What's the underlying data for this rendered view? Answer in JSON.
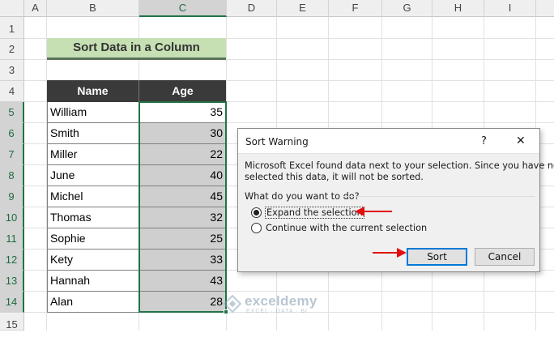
{
  "columns": [
    "A",
    "B",
    "C",
    "D",
    "E",
    "F",
    "G",
    "H",
    "I"
  ],
  "rows": [
    "1",
    "2",
    "3",
    "4",
    "5",
    "6",
    "7",
    "8",
    "9",
    "10",
    "11",
    "12",
    "13",
    "14",
    "15"
  ],
  "sheet_title": "Sort Data in a Column",
  "table": {
    "headers": [
      "Name",
      "Age"
    ],
    "rows": [
      {
        "name": "William",
        "age": "35"
      },
      {
        "name": "Smith",
        "age": "30"
      },
      {
        "name": "Miller",
        "age": "22"
      },
      {
        "name": "June",
        "age": "40"
      },
      {
        "name": "Michel",
        "age": "45"
      },
      {
        "name": "Thomas",
        "age": "32"
      },
      {
        "name": "Sophie",
        "age": "25"
      },
      {
        "name": "Kety",
        "age": "33"
      },
      {
        "name": "Hannah",
        "age": "43"
      },
      {
        "name": "Alan",
        "age": "28"
      }
    ]
  },
  "dialog": {
    "title": "Sort Warning",
    "help_icon": "?",
    "close_icon": "✕",
    "message_line1": "Microsoft Excel found data next to your selection.  Since you have not",
    "message_line2": "selected this data, it will not be sorted.",
    "question": "What do you want to do?",
    "option_expand": "Expand the selection",
    "option_continue": "Continue with the current selection",
    "selected_option": "expand",
    "sort_button": "Sort",
    "cancel_button": "Cancel"
  },
  "watermark": {
    "name": "exceldemy",
    "tagline": "EXCEL · DATA · BI"
  },
  "colors": {
    "accent": "#217346",
    "title_fill": "#c6e0b4",
    "header_fill": "#3a3a3a",
    "arrow": "#e01010"
  }
}
